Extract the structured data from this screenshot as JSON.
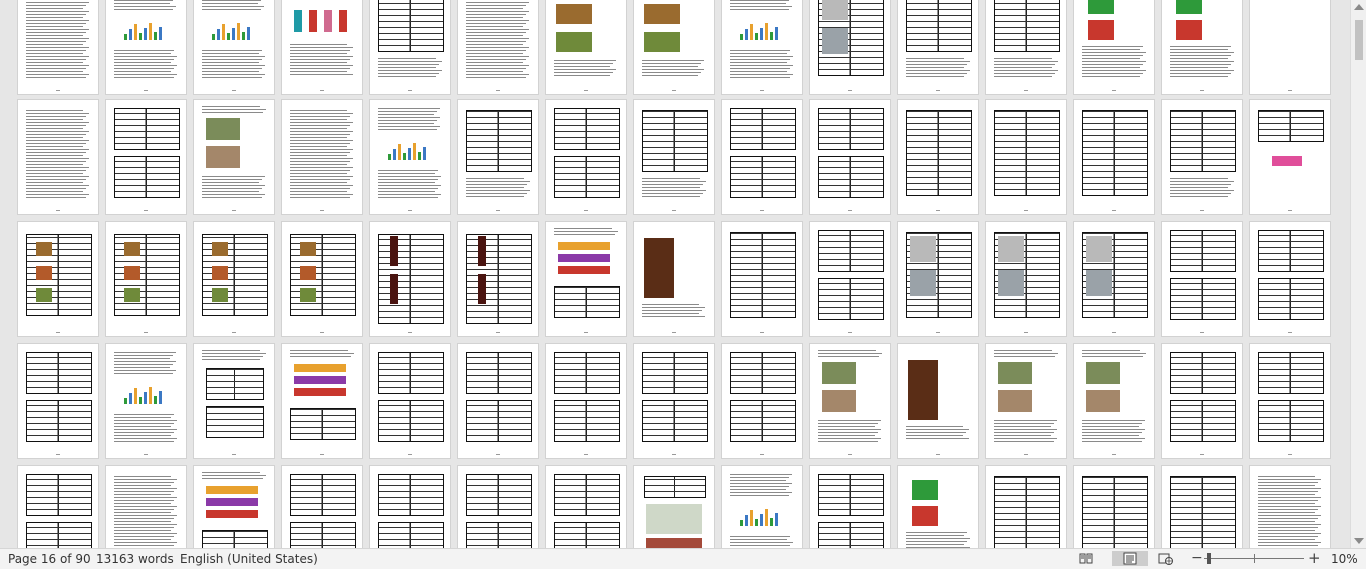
{
  "status_bar": {
    "page_indicator": "Page 16 of 90",
    "word_count": "13163 words",
    "language": "English (United States)",
    "zoom_level": "10%",
    "zoom_minus": "−",
    "zoom_plus": "+"
  },
  "view_modes": [
    {
      "name": "read-mode-icon",
      "active": false
    },
    {
      "name": "print-layout-icon",
      "active": true
    },
    {
      "name": "web-layout-icon",
      "active": false
    }
  ],
  "zoom_slider": {
    "fraction": 0.03
  },
  "colors": {
    "workspace": "#e6e6e6",
    "status_bar": "#f3f3f3",
    "chart_green": "#2e9a3a",
    "chart_orange": "#e8a12e",
    "chart_blue": "#3b78c4",
    "chart_red": "#c8372d",
    "food_photo": "#9a6b2f",
    "wine_bottle": "#4a1410"
  }
}
